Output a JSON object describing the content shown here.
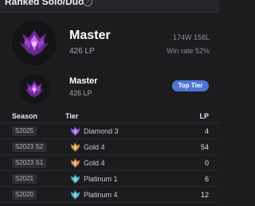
{
  "header": {
    "title": "Ranked Solo/Duo",
    "info_icon": "info-icon"
  },
  "solo": {
    "tier": "Master",
    "lp": "426 LP",
    "record": "174W 158L",
    "winrate": "Win rate 52%",
    "emblem_icon": "master-emblem-icon"
  },
  "flex": {
    "tier": "Master",
    "lp": "426 LP",
    "badge": "Top Tier",
    "emblem_icon": "master-emblem-icon"
  },
  "history": {
    "columns": {
      "season": "Season",
      "tier": "Tier",
      "lp": "LP"
    },
    "rows": [
      {
        "season": "S2025",
        "tier": "Diamond 3",
        "lp": "4",
        "icon": "diamond-emblem-icon",
        "color": "#9a5fe0"
      },
      {
        "season": "S2023 S2",
        "tier": "Gold 4",
        "lp": "54",
        "icon": "gold-emblem-icon",
        "color": "#d8944a"
      },
      {
        "season": "S2023 S1",
        "tier": "Gold 4",
        "lp": "0",
        "icon": "gold-emblem-icon",
        "color": "#d8944a"
      },
      {
        "season": "S2021",
        "tier": "Platinum 1",
        "lp": "6",
        "icon": "platinum-emblem-icon",
        "color": "#4fb4c8"
      },
      {
        "season": "S2020",
        "tier": "Platinum 4",
        "lp": "12",
        "icon": "platinum-emblem-icon",
        "color": "#4fb4c8"
      }
    ]
  },
  "colors": {
    "background": "#1c1c1f",
    "accent": "#4f75d6",
    "master": "#b25bd9"
  }
}
